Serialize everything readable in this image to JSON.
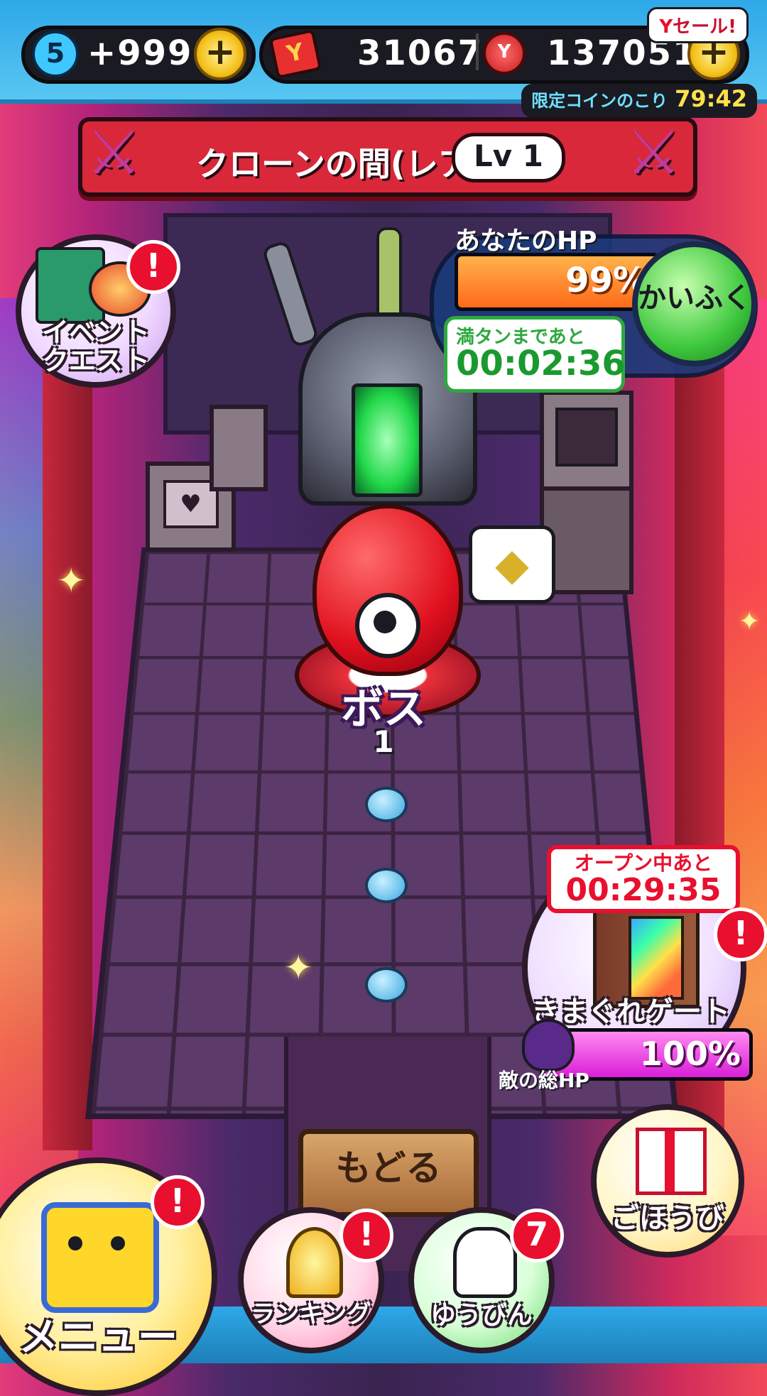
{
  "topbar": {
    "spirit_count": "5",
    "stamina_value": "+999",
    "ycard_count": "31067",
    "coin_count": "137051",
    "sale_label": "セール!",
    "limited_label": "限定コインのこり",
    "limited_time": "79:42",
    "plus_symbol": "+"
  },
  "stage": {
    "title": "クローンの間(レア)",
    "level": "Lv 1"
  },
  "event_quest": {
    "label_line1": "イベント",
    "label_line2": "クエスト",
    "alert": "!"
  },
  "hp": {
    "label": "あなたのHP",
    "percent_text": "99%",
    "percent_value": 99,
    "heal_label": "かいふく",
    "full_label": "満タンまであと",
    "full_time": "00:02:36"
  },
  "boss": {
    "label": "ボス",
    "number": "1"
  },
  "gate": {
    "open_label": "オープン中あと",
    "open_time": "00:29:35",
    "label": "きまぐれゲート",
    "alert": "!",
    "enemy_hp_text": "100%",
    "enemy_hp_value": 100,
    "enemy_hp_label": "敵の総HP"
  },
  "back_label": "もどる",
  "reward": {
    "label": "ごほうび"
  },
  "menu": {
    "label": "メニュー",
    "alert": "!"
  },
  "ranking": {
    "label": "ランキング",
    "alert": "!"
  },
  "mail": {
    "label": "ゆうびん",
    "badge": "7"
  },
  "colors": {
    "topbar": "#2ea8e8",
    "banner": "#d8283a",
    "hp_fill": "#ff6a1a",
    "heal_green": "#3ec83e",
    "alert_red": "#e8102e",
    "enemy_fill": "#d81ed8"
  }
}
